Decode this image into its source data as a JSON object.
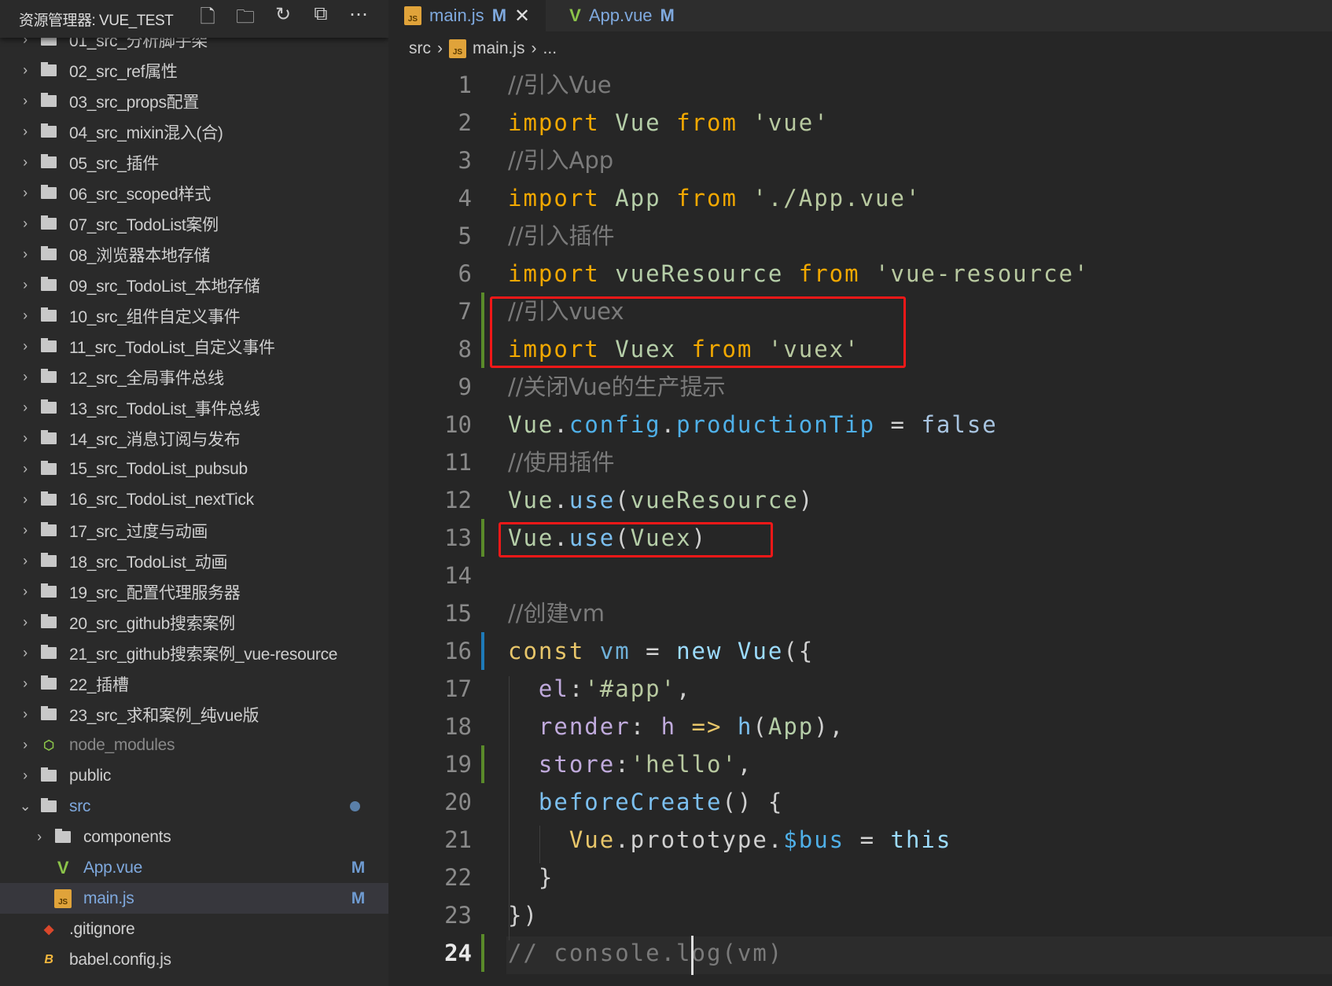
{
  "sidebar": {
    "title": "资源管理器: VUE_TEST",
    "actions": [
      "new-file-icon",
      "new-folder-icon",
      "refresh-icon",
      "collapse-icon",
      "more-icon"
    ],
    "items": [
      {
        "label": "01_src_分析脚手架",
        "type": "folder"
      },
      {
        "label": "02_src_ref属性",
        "type": "folder"
      },
      {
        "label": "03_src_props配置",
        "type": "folder"
      },
      {
        "label": "04_src_mixin混入(合)",
        "type": "folder"
      },
      {
        "label": "05_src_插件",
        "type": "folder"
      },
      {
        "label": "06_src_scoped样式",
        "type": "folder"
      },
      {
        "label": "07_src_TodoList案例",
        "type": "folder"
      },
      {
        "label": "08_浏览器本地存储",
        "type": "folder"
      },
      {
        "label": "09_src_TodoList_本地存储",
        "type": "folder"
      },
      {
        "label": "10_src_组件自定义事件",
        "type": "folder"
      },
      {
        "label": "11_src_TodoList_自定义事件",
        "type": "folder"
      },
      {
        "label": "12_src_全局事件总线",
        "type": "folder"
      },
      {
        "label": "13_src_TodoList_事件总线",
        "type": "folder"
      },
      {
        "label": "14_src_消息订阅与发布",
        "type": "folder"
      },
      {
        "label": "15_src_TodoList_pubsub",
        "type": "folder"
      },
      {
        "label": "16_src_TodoList_nextTick",
        "type": "folder"
      },
      {
        "label": "17_src_过度与动画",
        "type": "folder"
      },
      {
        "label": "18_src_TodoList_动画",
        "type": "folder"
      },
      {
        "label": "19_src_配置代理服务器",
        "type": "folder"
      },
      {
        "label": "20_src_github搜索案例",
        "type": "folder"
      },
      {
        "label": "21_src_github搜索案例_vue-resource",
        "type": "folder"
      },
      {
        "label": "22_插槽",
        "type": "folder"
      },
      {
        "label": "23_src_求和案例_纯vue版",
        "type": "folder"
      },
      {
        "label": "node_modules",
        "type": "node"
      },
      {
        "label": "public",
        "type": "folder"
      },
      {
        "label": "src",
        "type": "folder-open",
        "dot": true
      },
      {
        "label": "components",
        "type": "folder",
        "indent": 1
      },
      {
        "label": "App.vue",
        "type": "vue",
        "indent": 1,
        "badge": "M"
      },
      {
        "label": "main.js",
        "type": "js",
        "indent": 1,
        "badge": "M",
        "selected": true
      },
      {
        "label": ".gitignore",
        "type": "git"
      },
      {
        "label": "babel.config.js",
        "type": "babel"
      }
    ]
  },
  "tabs": [
    {
      "label": "main.js",
      "badge": "M",
      "icon": "js",
      "active": true
    },
    {
      "label": "App.vue",
      "badge": "M",
      "icon": "vue"
    }
  ],
  "breadcrumb": [
    "src",
    "main.js",
    "..."
  ],
  "code": [
    [
      [
        "//引入Vue",
        "cm"
      ]
    ],
    [
      [
        "import ",
        "kw"
      ],
      [
        "Vue ",
        "id"
      ],
      [
        "from ",
        "kw"
      ],
      [
        "'vue'",
        "str"
      ]
    ],
    [
      [
        "//引入App",
        "cm"
      ]
    ],
    [
      [
        "import ",
        "kw"
      ],
      [
        "App ",
        "id"
      ],
      [
        "from ",
        "kw"
      ],
      [
        "'./App.vue'",
        "str"
      ]
    ],
    [
      [
        "//引入插件",
        "cm"
      ]
    ],
    [
      [
        "import ",
        "kw"
      ],
      [
        "vueResource ",
        "id"
      ],
      [
        "from ",
        "kw"
      ],
      [
        "'vue-resource'",
        "str"
      ]
    ],
    [
      [
        "//引入vuex",
        "cm"
      ]
    ],
    [
      [
        "import ",
        "kw"
      ],
      [
        "Vuex ",
        "id"
      ],
      [
        "from ",
        "kw"
      ],
      [
        "'vuex'",
        "str"
      ]
    ],
    [
      [
        "//关闭Vue的生产提示",
        "cm"
      ]
    ],
    [
      [
        "Vue",
        "id"
      ],
      [
        ".",
        "pl"
      ],
      [
        "config",
        "prop"
      ],
      [
        ".",
        "pl"
      ],
      [
        "productionTip",
        "prop"
      ],
      [
        " = ",
        "op"
      ],
      [
        "false",
        "bool"
      ]
    ],
    [
      [
        "//使用插件",
        "cm"
      ]
    ],
    [
      [
        "Vue",
        "id"
      ],
      [
        ".",
        "pl"
      ],
      [
        "use",
        "fn"
      ],
      [
        "(",
        "pl"
      ],
      [
        "vueResource",
        "id"
      ],
      [
        ")",
        "pl"
      ]
    ],
    [
      [
        "Vue",
        "id"
      ],
      [
        ".",
        "pl"
      ],
      [
        "use",
        "fn"
      ],
      [
        "(",
        "pl"
      ],
      [
        "Vuex",
        "id"
      ],
      [
        ")",
        "pl"
      ]
    ],
    [],
    [
      [
        "//创建vm",
        "cm"
      ]
    ],
    [
      [
        "const ",
        "yl"
      ],
      [
        "vm",
        "var"
      ],
      [
        " = ",
        "op"
      ],
      [
        "new ",
        "new"
      ],
      [
        "Vue",
        "cls"
      ],
      [
        "({",
        "pl"
      ]
    ],
    [
      [
        "  el",
        "key"
      ],
      [
        ":",
        "pl"
      ],
      [
        "'#app'",
        "str"
      ],
      [
        ",",
        "pl"
      ]
    ],
    [
      [
        "  render",
        "key"
      ],
      [
        ": ",
        "pl"
      ],
      [
        "h",
        "key"
      ],
      [
        " => ",
        "yl"
      ],
      [
        "h",
        "fn"
      ],
      [
        "(",
        "pl"
      ],
      [
        "App",
        "id"
      ],
      [
        "),",
        "pl"
      ]
    ],
    [
      [
        "  store",
        "key"
      ],
      [
        ":",
        "pl"
      ],
      [
        "'hello'",
        "str"
      ],
      [
        ",",
        "pl"
      ]
    ],
    [
      [
        "  beforeCreate",
        "fn"
      ],
      [
        "() {",
        "pl"
      ]
    ],
    [
      [
        "    Vue",
        "yl"
      ],
      [
        ".prototype.",
        "pl"
      ],
      [
        "$bus",
        "prop"
      ],
      [
        " = ",
        "op"
      ],
      [
        "this",
        "new"
      ]
    ],
    [
      [
        "  }",
        "pl"
      ]
    ],
    [
      [
        "})",
        "pl"
      ]
    ],
    [
      [
        "// console.log(vm)",
        "cm"
      ]
    ]
  ],
  "current_line": 24,
  "gutter_marks": {
    "added": [
      7,
      8,
      13,
      19,
      24
    ],
    "modified": [
      16
    ]
  },
  "highlight_color": "#f01818"
}
